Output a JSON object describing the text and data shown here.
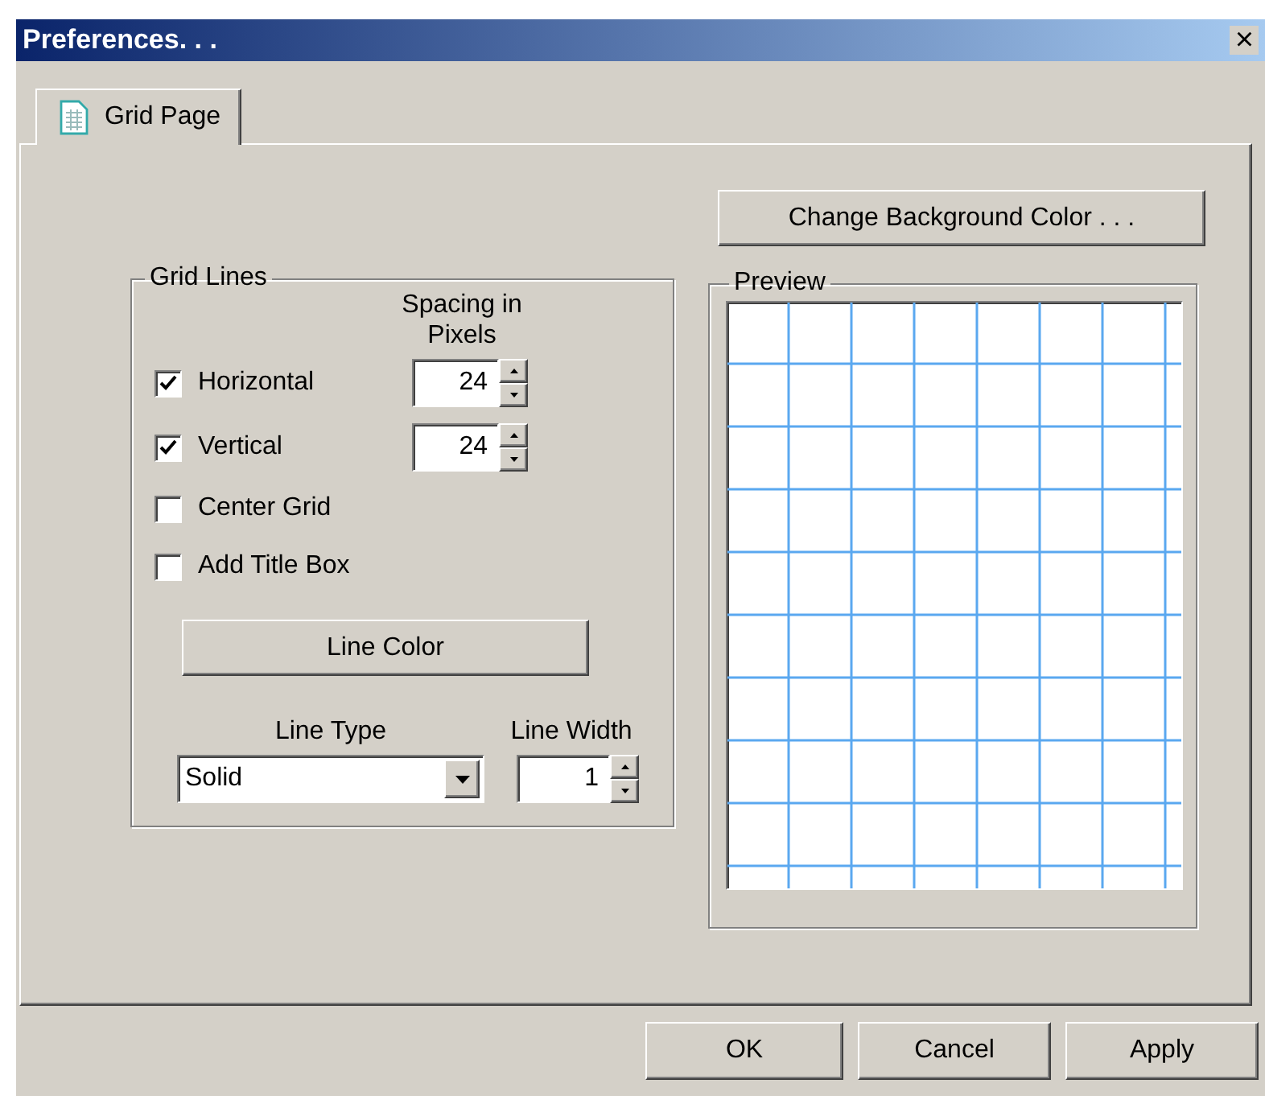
{
  "window": {
    "title": "Preferences. . .",
    "close": "×"
  },
  "tabs": [
    {
      "label": "Grid Page",
      "selected": true
    }
  ],
  "grid_lines": {
    "title": "Grid Lines",
    "spacing_header": "Spacing in Pixels",
    "options": [
      {
        "label": "Horizontal",
        "checked": true,
        "spacing": "24"
      },
      {
        "label": "Vertical",
        "checked": true,
        "spacing": "24"
      },
      {
        "label": "Center Grid",
        "checked": false
      },
      {
        "label": "Add Title Box",
        "checked": false
      }
    ],
    "line_color_button": "Line Color",
    "line_type": {
      "label": "Line Type",
      "value": "Solid"
    },
    "line_width": {
      "label": "Line Width",
      "value": "1"
    }
  },
  "change_background_button": "Change Background Color . . .",
  "preview": {
    "title": "Preview"
  },
  "buttons": [
    "OK",
    "Cancel",
    "Apply"
  ]
}
